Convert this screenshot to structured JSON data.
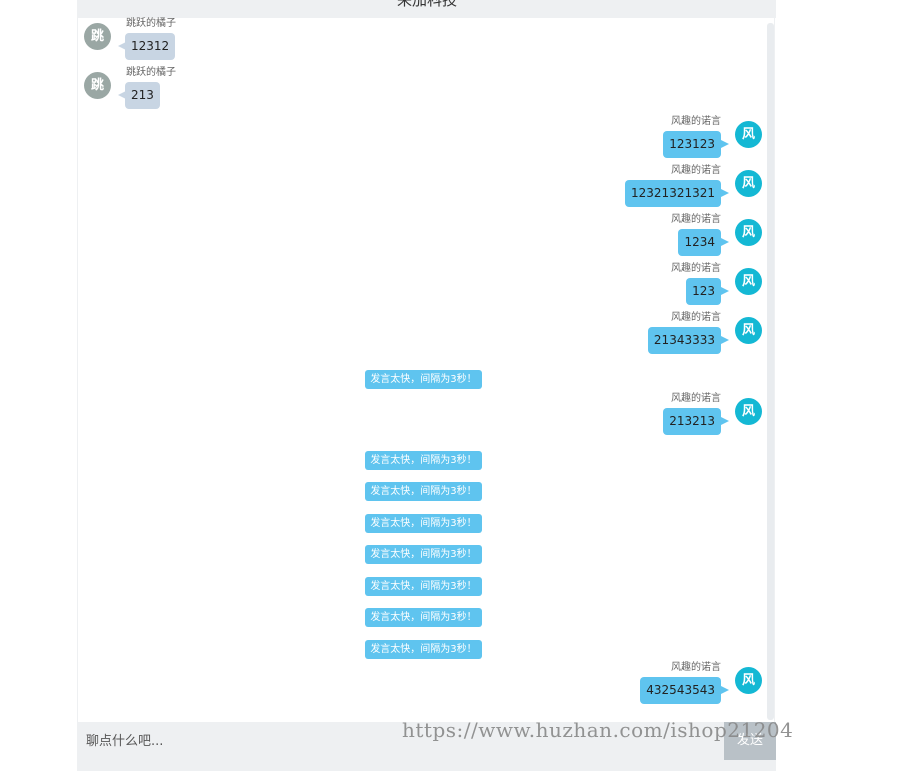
{
  "header": {
    "title": "来加科技"
  },
  "messages": [
    {
      "type": "user",
      "side": "left",
      "name": "跳跃的橘子",
      "avatar": "跳",
      "text": "12312"
    },
    {
      "type": "user",
      "side": "left",
      "name": "跳跃的橘子",
      "avatar": "跳",
      "text": "213"
    },
    {
      "type": "user",
      "side": "right",
      "name": "风趣的诺言",
      "avatar": "风",
      "text": "123123"
    },
    {
      "type": "user",
      "side": "right",
      "name": "风趣的诺言",
      "avatar": "风",
      "text": "12321321321"
    },
    {
      "type": "user",
      "side": "right",
      "name": "风趣的诺言",
      "avatar": "风",
      "text": "1234"
    },
    {
      "type": "user",
      "side": "right",
      "name": "风趣的诺言",
      "avatar": "风",
      "text": "123"
    },
    {
      "type": "user",
      "side": "right",
      "name": "风趣的诺言",
      "avatar": "风",
      "text": "21343333"
    },
    {
      "type": "system",
      "text": "发言太快，间隔为3秒！"
    },
    {
      "type": "user",
      "side": "right",
      "name": "风趣的诺言",
      "avatar": "风",
      "text": "213213"
    },
    {
      "type": "system",
      "text": "发言太快，间隔为3秒！"
    },
    {
      "type": "system",
      "text": "发言太快，间隔为3秒！"
    },
    {
      "type": "system",
      "text": "发言太快，间隔为3秒！"
    },
    {
      "type": "system",
      "text": "发言太快，间隔为3秒！"
    },
    {
      "type": "system",
      "text": "发言太快，间隔为3秒！"
    },
    {
      "type": "system",
      "text": "发言太快，间隔为3秒！"
    },
    {
      "type": "system",
      "text": "发言太快，间隔为3秒！"
    },
    {
      "type": "user",
      "side": "right",
      "name": "风趣的诺言",
      "avatar": "风",
      "text": "432543543"
    }
  ],
  "input": {
    "placeholder": "聊点什么吧..."
  },
  "send_button": {
    "label": "发送"
  },
  "watermark": "https://www.huzhan.com/ishop21204",
  "colors": {
    "left_bubble": "#c8d5e3",
    "right_bubble": "#5fc4ef",
    "left_avatar": "#9aa7a4",
    "right_avatar": "#14b8d4",
    "system_notice": "#5fc4ef"
  }
}
